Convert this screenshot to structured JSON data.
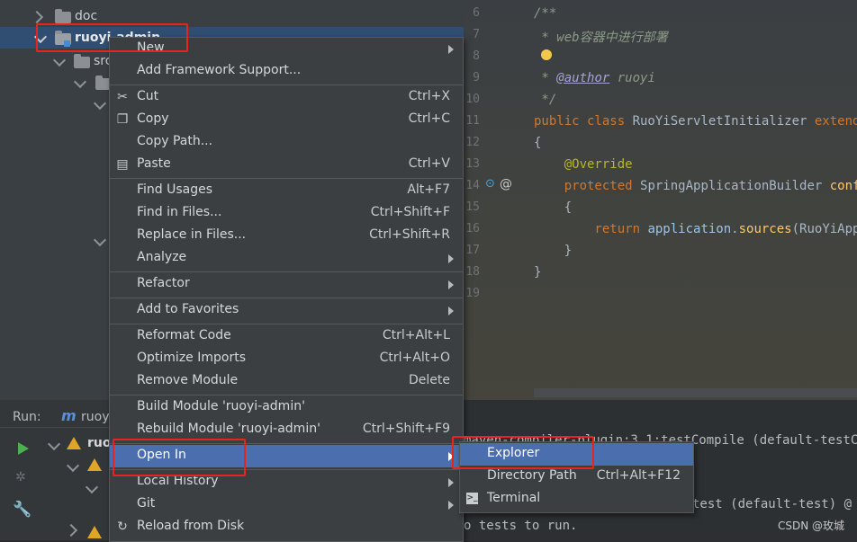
{
  "project_tree": {
    "items": [
      {
        "label": "doc"
      },
      {
        "label": "ruoyi-admin"
      },
      {
        "label": "src"
      }
    ]
  },
  "editor": {
    "line_numbers": [
      "6",
      "7",
      "8",
      "9",
      "10",
      "11",
      "12",
      "13",
      "14",
      "15",
      "16",
      "17",
      "18",
      "19"
    ],
    "lines": {
      "l6": "/**",
      "l7a": " * ",
      "l7b": "web容器中进行部署",
      "l9a": " * ",
      "l9b": "@author",
      "l9c": " ruoyi",
      "l10": " */",
      "l11a": "public class ",
      "l11b": "RuoYiServletInitializer ",
      "l11c": "extends",
      "l12": "{",
      "l13": "    @Override",
      "l14a": "    protected ",
      "l14b": "SpringApplicationBuilder ",
      "l14c": "configu",
      "l15": "    {",
      "l16a": "        return ",
      "l16b": "application",
      "l16c": ".",
      "l16d": "sources",
      "l16e": "(RuoYiAppli",
      "l17": "    }",
      "l18": "}"
    }
  },
  "run_panel": {
    "label": "Run:",
    "tab_name": "ruoy",
    "tree_item": "ruo",
    "output": [
      "maven-compiler-plugin:3.1:testCompile (default-testC",
      "test (default-test) @ r",
      "o tests to run."
    ]
  },
  "context_menu": {
    "items": [
      {
        "label": "New",
        "shortcut": "",
        "submenu": true
      },
      {
        "label": "Add Framework Support...",
        "shortcut": ""
      },
      {
        "label": "Cut",
        "shortcut": "Ctrl+X",
        "icon": "scissors-icon"
      },
      {
        "label": "Copy",
        "shortcut": "Ctrl+C",
        "icon": "copy-icon"
      },
      {
        "label": "Copy Path...",
        "shortcut": ""
      },
      {
        "label": "Paste",
        "shortcut": "Ctrl+V",
        "icon": "clipboard-icon"
      },
      {
        "label": "Find Usages",
        "shortcut": "Alt+F7"
      },
      {
        "label": "Find in Files...",
        "shortcut": "Ctrl+Shift+F"
      },
      {
        "label": "Replace in Files...",
        "shortcut": "Ctrl+Shift+R"
      },
      {
        "label": "Analyze",
        "shortcut": "",
        "submenu": true
      },
      {
        "label": "Refactor",
        "shortcut": "",
        "submenu": true
      },
      {
        "label": "Add to Favorites",
        "shortcut": "",
        "submenu": true
      },
      {
        "label": "Reformat Code",
        "shortcut": "Ctrl+Alt+L"
      },
      {
        "label": "Optimize Imports",
        "shortcut": "Ctrl+Alt+O"
      },
      {
        "label": "Remove Module",
        "shortcut": "Delete"
      },
      {
        "label": "Build Module 'ruoyi-admin'",
        "shortcut": ""
      },
      {
        "label": "Rebuild Module 'ruoyi-admin'",
        "shortcut": "Ctrl+Shift+F9"
      },
      {
        "label": "Open In",
        "shortcut": "",
        "submenu": true,
        "highlighted": true
      },
      {
        "label": "Local History",
        "shortcut": "",
        "submenu": true
      },
      {
        "label": "Git",
        "shortcut": "",
        "submenu": true
      },
      {
        "label": "Reload from Disk",
        "shortcut": "",
        "icon": "reload-icon"
      }
    ]
  },
  "open_in_submenu": {
    "items": [
      {
        "label": "Explorer",
        "shortcut": "",
        "highlighted": true
      },
      {
        "label": "Directory Path",
        "shortcut": "Ctrl+Alt+F12"
      },
      {
        "label": "Terminal",
        "shortcut": "",
        "icon": "terminal-icon"
      }
    ]
  },
  "watermark": "CSDN @玫城",
  "colors": {
    "highlight": "#4b6eaf",
    "menu_bg": "#3c3f41",
    "annotation_box": "#e8241d"
  }
}
